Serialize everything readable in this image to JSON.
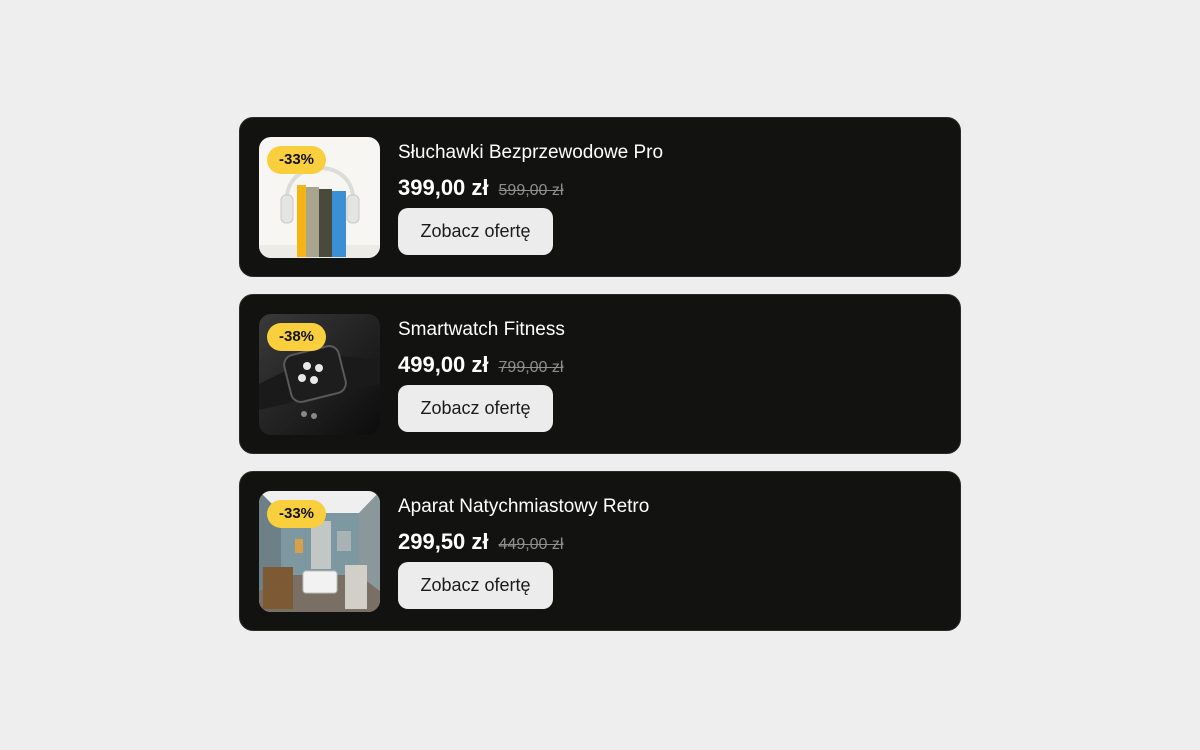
{
  "products": [
    {
      "discount": "-33%",
      "title": "Słuchawki Bezprzewodowe Pro",
      "price": "399,00 zł",
      "old_price": "599,00 zł",
      "cta": "Zobacz ofertę",
      "image": "headphones-on-books-photo"
    },
    {
      "discount": "-38%",
      "title": "Smartwatch Fitness",
      "price": "499,00 zł",
      "old_price": "799,00 zł",
      "cta": "Zobacz ofertę",
      "image": "smartwatch-photo"
    },
    {
      "discount": "-33%",
      "title": "Aparat Natychmiastowy Retro",
      "price": "299,50 zł",
      "old_price": "449,00 zł",
      "cta": "Zobacz ofertę",
      "image": "interior-room-photo"
    }
  ],
  "colors": {
    "page_background": "#eeeeee",
    "card_background": "#121210",
    "badge_background": "#f9cf3e",
    "button_background": "#ececec",
    "old_price": "#8e8e8e"
  }
}
